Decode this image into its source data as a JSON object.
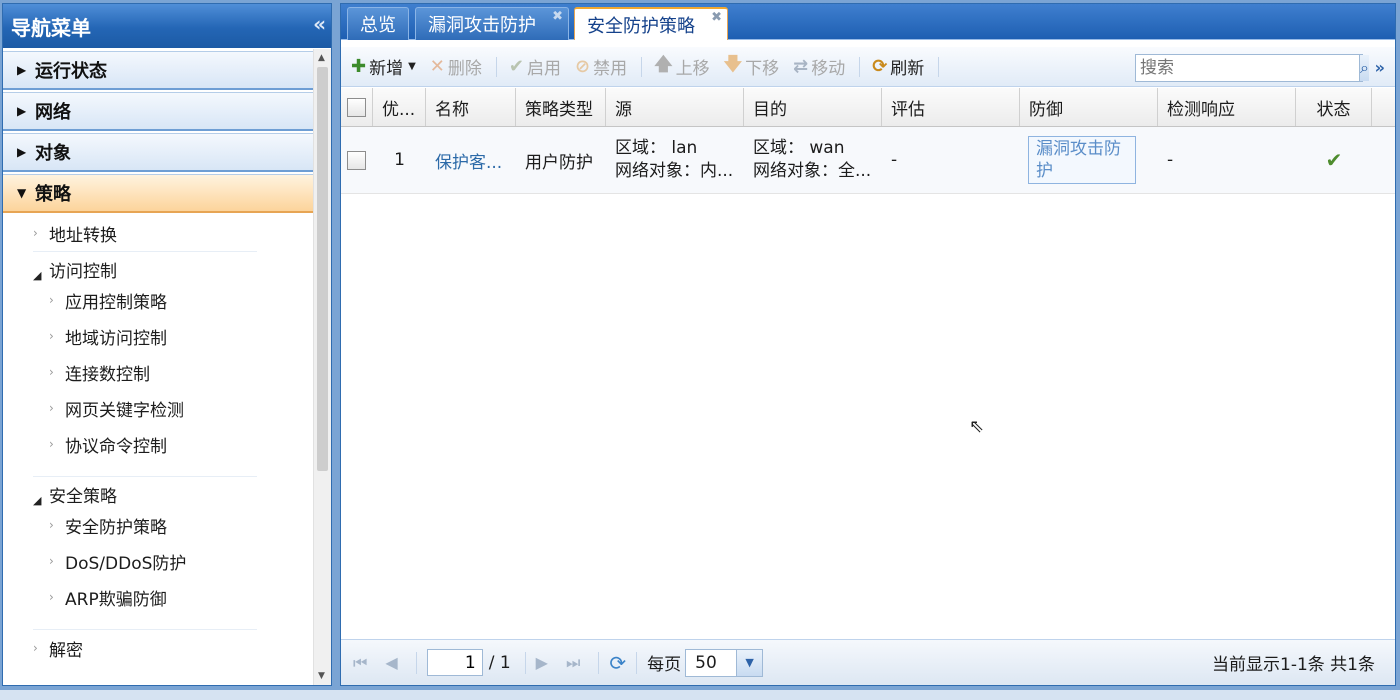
{
  "nav": {
    "title": "导航菜单",
    "collapse": "«",
    "sections": {
      "status": "运行状态",
      "network": "网络",
      "objects": "对象",
      "policy": "策略",
      "decrypt": "解密"
    },
    "nat": "地址转换",
    "access_control": {
      "label": "访问控制",
      "items": [
        "应用控制策略",
        "地域访问控制",
        "连接数控制",
        "网页关键字检测",
        "协议命令控制"
      ]
    },
    "security_policy": {
      "label": "安全策略",
      "items": [
        "安全防护策略",
        "DoS/DDoS防护",
        "ARP欺骗防御"
      ]
    }
  },
  "tabs": [
    {
      "label": "总览",
      "closable": false
    },
    {
      "label": "漏洞攻击防护",
      "closable": true
    },
    {
      "label": "安全防护策略",
      "closable": true,
      "active": true
    }
  ],
  "toolbar": {
    "add": "新增",
    "delete": "删除",
    "enable": "启用",
    "disable": "禁用",
    "move_up": "上移",
    "move_down": "下移",
    "move": "移动",
    "refresh": "刷新",
    "search_placeholder": "搜索"
  },
  "grid": {
    "columns": [
      "优...",
      "名称",
      "策略类型",
      "源",
      "目的",
      "评估",
      "防御",
      "检测响应",
      "状态"
    ],
    "rows": [
      {
        "priority": "1",
        "name": "保护客...",
        "type": "用户防护",
        "src_zone": "区域： lan",
        "src_obj": "网络对象：内...",
        "dst_zone": "区域： wan",
        "dst_obj": "网络对象：全...",
        "assess": "-",
        "defense": "漏洞攻击防护",
        "detect": "-",
        "status": "enabled"
      }
    ]
  },
  "pager": {
    "page": "1",
    "total_pages": "/ 1",
    "per_page_label": "每页",
    "per_page": "50",
    "info": "当前显示1-1条 共1条"
  },
  "colors": {
    "header_blue": "#2466b5",
    "active_section": "#fcd49b",
    "link": "#2c6aa8",
    "check_green": "#4e8c2e"
  }
}
